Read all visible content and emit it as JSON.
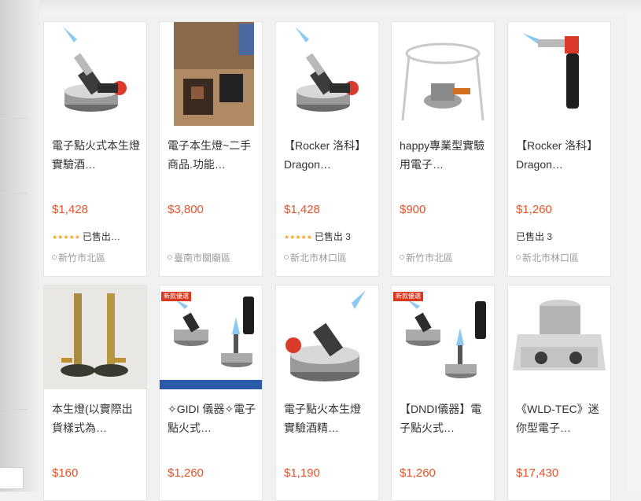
{
  "theme": {
    "price_color": "#e8522a",
    "star_color": "#f6a623",
    "location_color": "#9a9a9a"
  },
  "products": [
    {
      "title": "電子點火式本生燈 實驗酒…",
      "price": "$1,428",
      "rating_stars": "★★★★★",
      "sold": "已售出…",
      "location": "新竹市北區",
      "image_icon": "torch-burner-icon"
    },
    {
      "title": "電子本生燈~二手商品.功能…",
      "price": "$3,800",
      "location": "臺南市關廟區",
      "image_icon": "used-device-photo"
    },
    {
      "title": "【Rocker 洛科】Dragon…",
      "price": "$1,428",
      "rating_stars": "★★★★★",
      "sold": "已售出 3",
      "location": "新北市林口區",
      "image_icon": "torch-burner-icon"
    },
    {
      "title": "happy專業型實驗用電子…",
      "price": "$900",
      "location": "新竹市北區",
      "image_icon": "burner-stand-icon"
    },
    {
      "title": "【Rocker 洛科】Dragon…",
      "price": "$1,260",
      "sold": "已售出 3",
      "location": "新北市林口區",
      "image_icon": "handheld-torch-icon"
    },
    {
      "title": "本生燈(以實際出貨樣式為…",
      "price": "$160",
      "image_icon": "brass-burners-icon"
    },
    {
      "title": "✧GIDI 儀器✧電子點火式…",
      "price": "$1,260",
      "badge": "新款優選",
      "image_icon": "torch-set-icon"
    },
    {
      "title": "電子點火本生燈 實驗酒精…",
      "price": "$1,190",
      "image_icon": "torch-burner-icon"
    },
    {
      "title": "【DNDI儀器】電子點火式…",
      "price": "$1,260",
      "badge": "新款優選",
      "image_icon": "torch-set-icon"
    },
    {
      "title": "《WLD-TEC》迷你型電子…",
      "price": "$17,430",
      "image_icon": "lab-heater-icon"
    }
  ]
}
